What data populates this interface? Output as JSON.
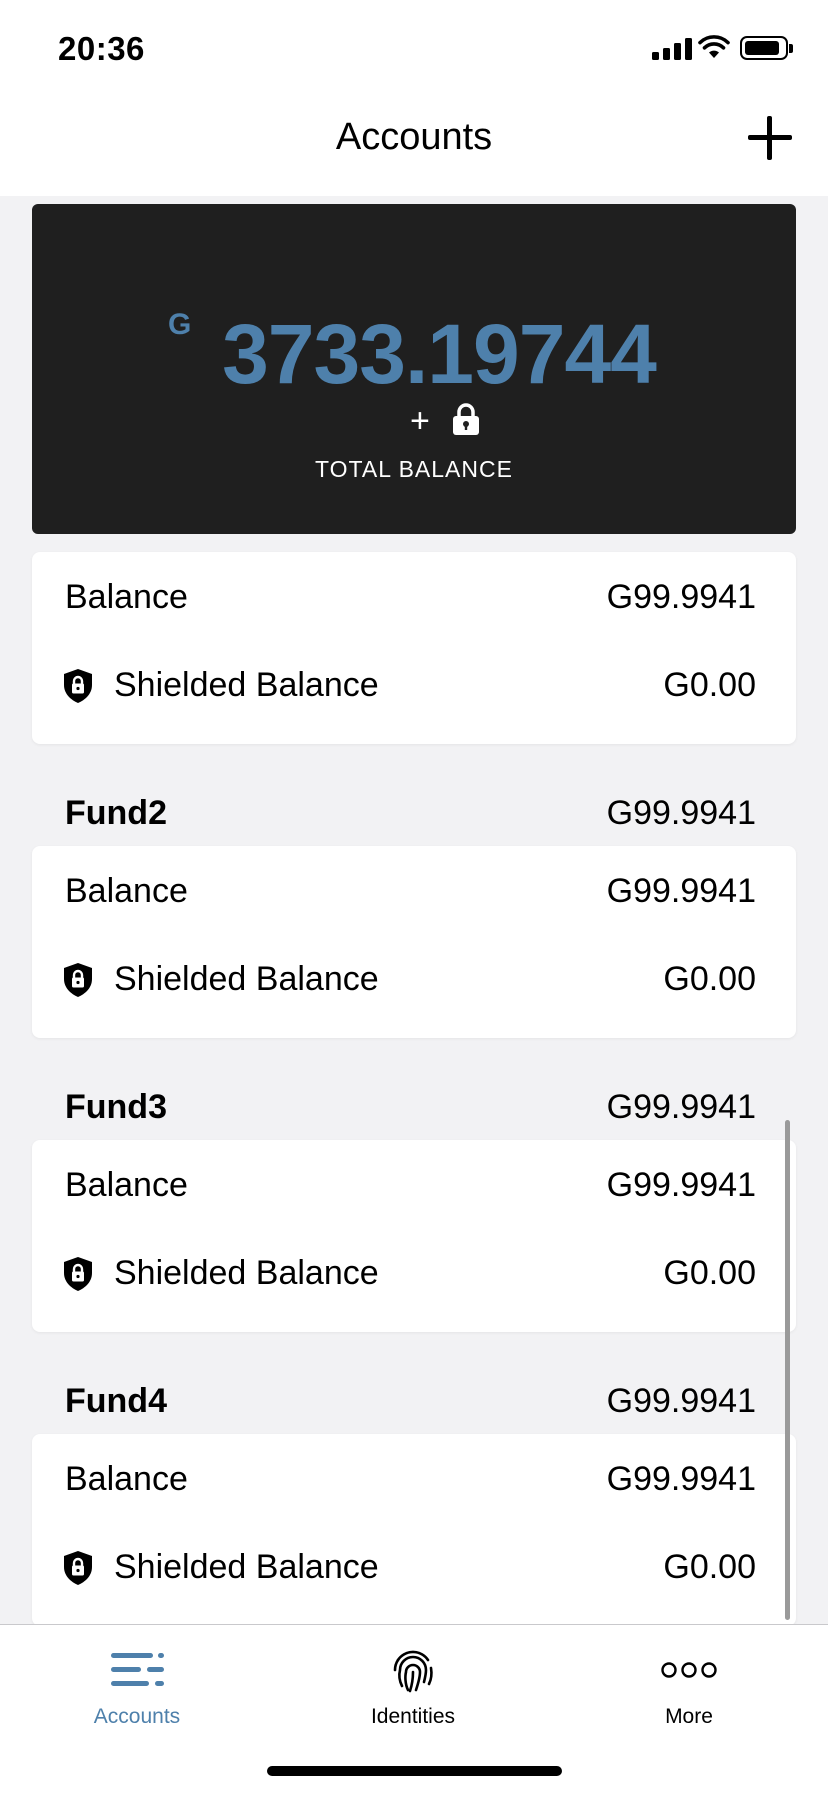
{
  "status_bar": {
    "time": "20:36"
  },
  "header": {
    "title": "Accounts",
    "add_icon": "plus-icon"
  },
  "total": {
    "currency_symbol": "G",
    "amount": "3733.19744",
    "plus": "+",
    "label": "TOTAL BALANCE",
    "lock_icon": "lock-icon"
  },
  "accounts": [
    {
      "name": "",
      "total": "",
      "balance_label": "Balance",
      "balance": "G99.9941",
      "shielded_label": "Shielded Balance",
      "shielded": "G0.00"
    },
    {
      "name": "Fund2",
      "total": "G99.9941",
      "balance_label": "Balance",
      "balance": "G99.9941",
      "shielded_label": "Shielded Balance",
      "shielded": "G0.00"
    },
    {
      "name": "Fund3",
      "total": "G99.9941",
      "balance_label": "Balance",
      "balance": "G99.9941",
      "shielded_label": "Shielded Balance",
      "shielded": "G0.00"
    },
    {
      "name": "Fund4",
      "total": "G99.9941",
      "balance_label": "Balance",
      "balance": "G99.9941",
      "shielded_label": "Shielded Balance",
      "shielded": "G0.00"
    }
  ],
  "tabs": [
    {
      "label": "Accounts",
      "icon": "list-icon",
      "active": true
    },
    {
      "label": "Identities",
      "icon": "fingerprint-icon",
      "active": false
    },
    {
      "label": "More",
      "icon": "more-icon",
      "active": false
    }
  ],
  "colors": {
    "accent": "#4e80ab",
    "card_dark": "#1f1f1f",
    "background": "#f2f2f4"
  }
}
